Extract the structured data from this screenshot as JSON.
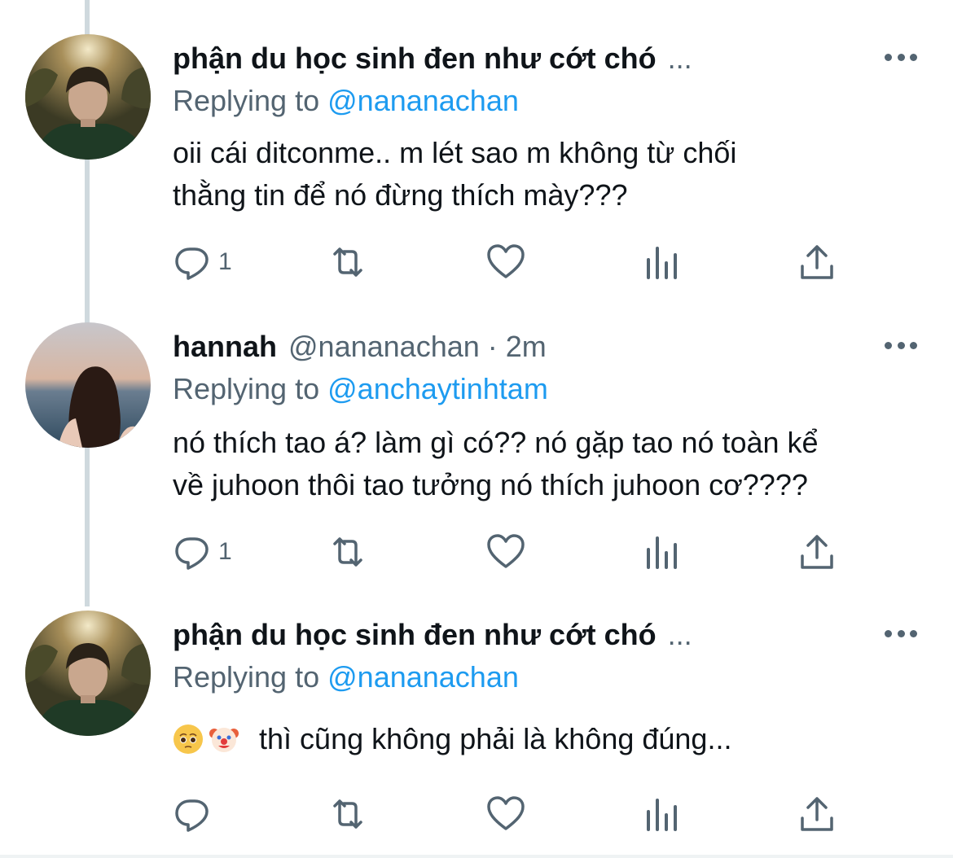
{
  "colors": {
    "primary_text": "#0f1419",
    "secondary_text": "#536471",
    "mention": "#1d9bf0",
    "thread_line": "#cfd9de"
  },
  "tweets": [
    {
      "display_name": "phận du học sinh đen như cớt chó",
      "name_truncation": "...",
      "handle": "",
      "time": "",
      "replying_prefix": "Replying to",
      "replying_to": "@nananachan",
      "text_lines": [
        "oii cái ditconme.. m lét sao m không từ chối",
        "thằng tin để nó đừng thích mày???"
      ],
      "reply_count": "1",
      "avatar_icon": "avatar-boy-forest"
    },
    {
      "display_name": "hannah",
      "name_truncation": "",
      "handle": "@nananachan",
      "separator": "·",
      "time": "2m",
      "replying_prefix": "Replying to",
      "replying_to": "@anchaytinhtam",
      "text_lines": [
        "nó thích tao á? làm gì có?? nó gặp tao nó toàn kể",
        "về juhoon thôi tao tưởng nó thích juhoon cơ????"
      ],
      "reply_count": "1",
      "avatar_icon": "avatar-girl-sea"
    },
    {
      "display_name": "phận du học sinh đen như cớt chó",
      "name_truncation": "...",
      "handle": "",
      "time": "",
      "replying_prefix": "Replying to",
      "replying_to": "@nananachan",
      "emojis": [
        "pleading-face-emoji",
        "clown-face-emoji"
      ],
      "text_lines": [
        "thì cũng không phải là không đúng..."
      ],
      "reply_count": "",
      "avatar_icon": "avatar-boy-forest"
    }
  ],
  "action_icons": [
    "reply-icon",
    "retweet-icon",
    "like-icon",
    "analytics-icon",
    "share-icon"
  ]
}
